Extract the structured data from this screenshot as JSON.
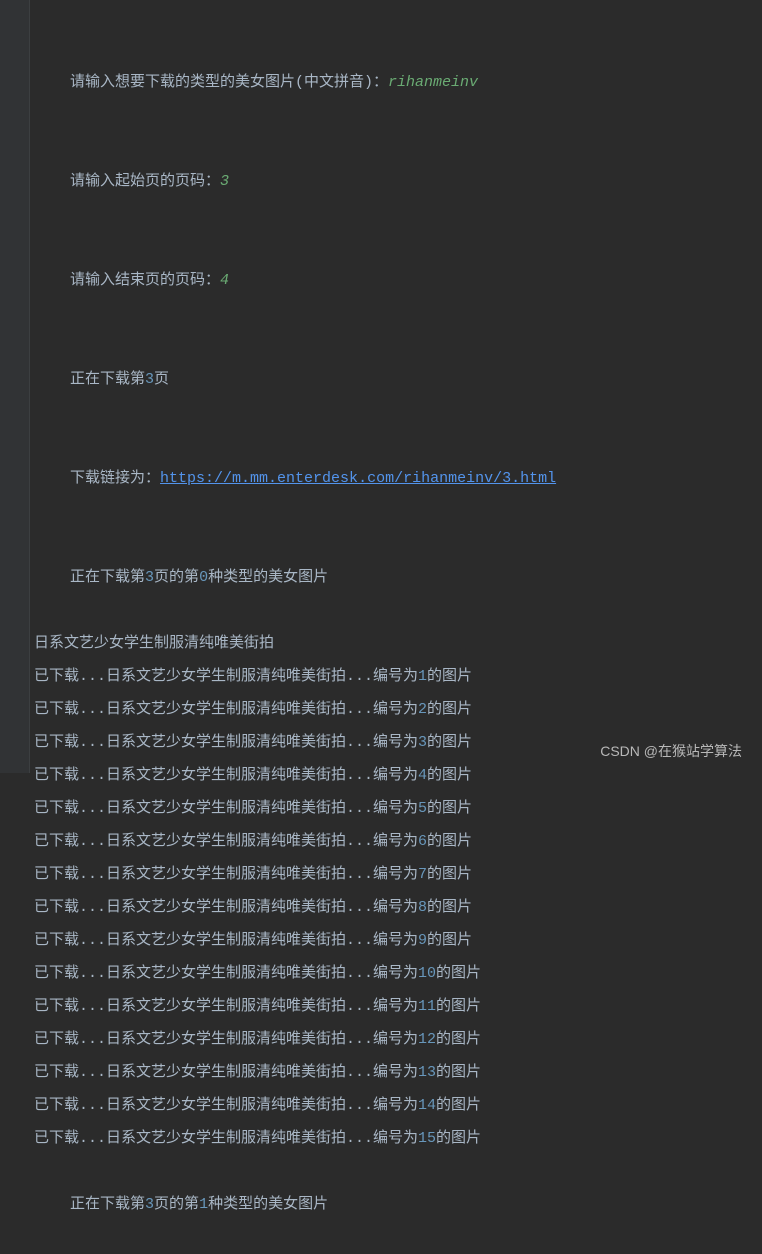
{
  "top_dim": "  ",
  "prompt1_text": "请输入想要下载的类型的美女图片(中文拼音)：",
  "prompt1_input": "rihanmeinv",
  "prompt2_text": "请输入起始页的页码：",
  "prompt2_input": "3",
  "prompt3_text": "请输入结束页的页码：",
  "prompt3_input": "4",
  "downloading_page_a": "正在下载第",
  "downloading_page_num": "3",
  "downloading_page_b": "页",
  "link_prefix": "下载链接为：",
  "link_url": "https://m.mm.enterdesk.com/rihanmeinv/3.html",
  "cat_line_a": "正在下载第",
  "cat_line_b": "页的第",
  "cat_line_c": "种类型的美女图片",
  "cat_page": "3",
  "cat_type0": "0",
  "cat_type1": "1",
  "title_line": "日系文艺少女学生制服清纯唯美街拍",
  "dl_prefix": "已下载...日系文艺少女学生制服清纯唯美街拍...编号为",
  "dl_suffix": "的图片",
  "items": [
    "1",
    "2",
    "3",
    "4",
    "5",
    "6",
    "7",
    "8",
    "9",
    "10",
    "11",
    "12",
    "13",
    "14",
    "15"
  ],
  "watermark": "CSDN @在猴站学算法"
}
